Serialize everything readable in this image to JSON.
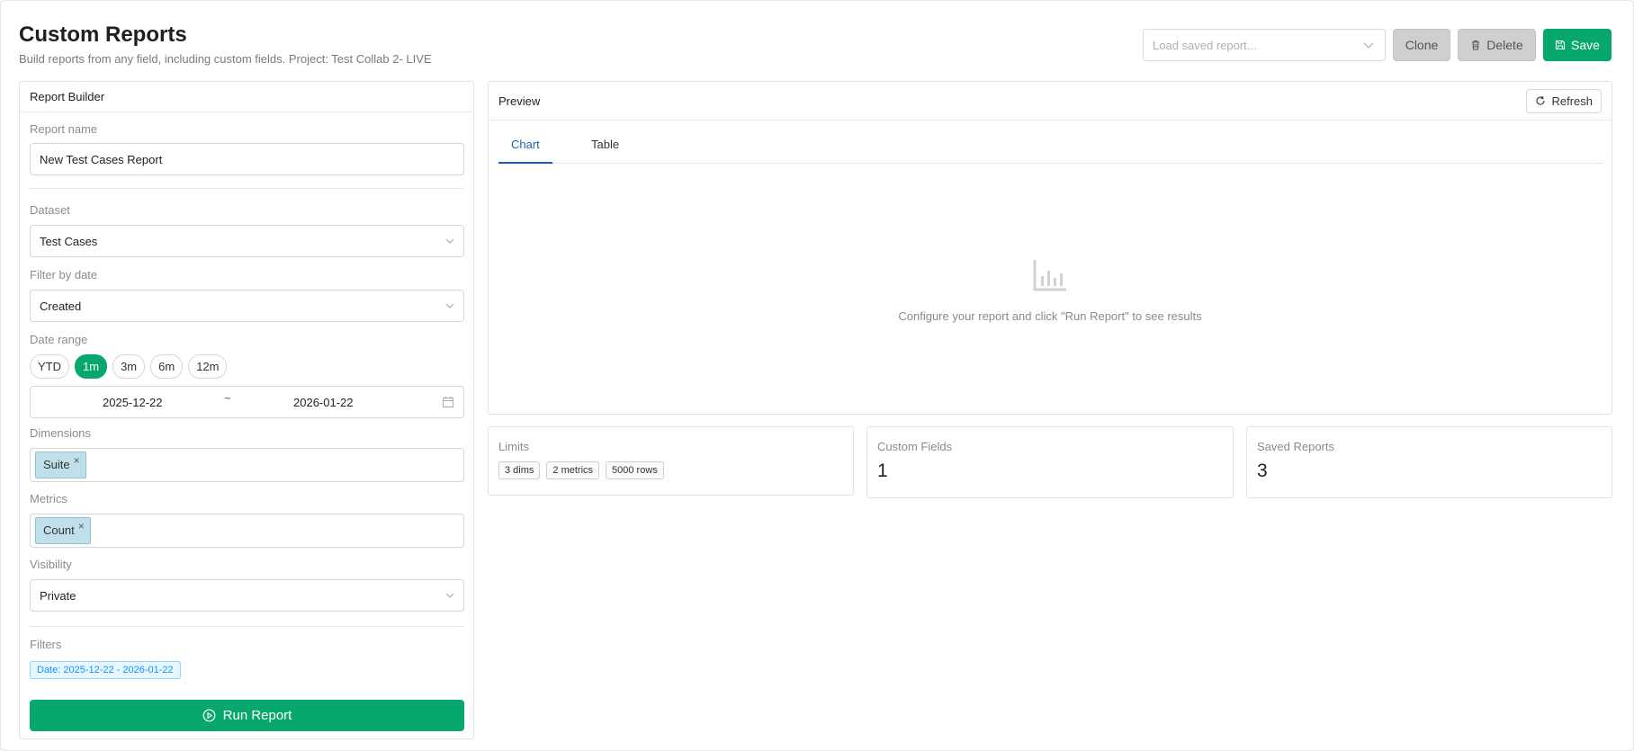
{
  "header": {
    "title": "Custom Reports",
    "subtitle": "Build reports from any field, including custom fields. Project: Test Collab 2- LIVE"
  },
  "toolbar": {
    "load_placeholder": "Load saved report...",
    "clone_label": "Clone",
    "delete_label": "Delete",
    "save_label": "Save"
  },
  "builder": {
    "title": "Report Builder",
    "report_name_label": "Report name",
    "report_name_value": "New Test Cases Report",
    "dataset_label": "Dataset",
    "dataset_value": "Test Cases",
    "filter_date_label": "Filter by date",
    "filter_date_value": "Created",
    "date_range_label": "Date range",
    "ranges": [
      {
        "label": "YTD",
        "active": false
      },
      {
        "label": "1m",
        "active": true
      },
      {
        "label": "3m",
        "active": false
      },
      {
        "label": "6m",
        "active": false
      },
      {
        "label": "12m",
        "active": false
      }
    ],
    "date_start": "2025-12-22",
    "date_separator": "~",
    "date_end": "2026-01-22",
    "dimensions_label": "Dimensions",
    "dimensions": [
      "Suite"
    ],
    "metrics_label": "Metrics",
    "metrics": [
      "Count"
    ],
    "visibility_label": "Visibility",
    "visibility_value": "Private",
    "filters_label": "Filters",
    "filter_badge": "Date: 2025-12-22 - 2026-01-22",
    "run_label": "Run Report"
  },
  "preview": {
    "title": "Preview",
    "refresh_label": "Refresh",
    "tabs": [
      "Chart",
      "Table"
    ],
    "active_tab": "Chart",
    "empty_text": "Configure your report and click \"Run Report\" to see results"
  },
  "stats": {
    "limits_title": "Limits",
    "limits": [
      "3 dims",
      "2 metrics",
      "5000 rows"
    ],
    "custom_fields_title": "Custom Fields",
    "custom_fields_value": "1",
    "saved_reports_title": "Saved Reports",
    "saved_reports_value": "3"
  },
  "colors": {
    "accent_green": "#07a86e",
    "tab_blue": "#1f5fa8",
    "tag_blue": "#bfe0ea",
    "filter_badge_blue": "#1890ff"
  },
  "icons": {
    "load_chevron": "chevron-down-icon",
    "delete": "trash-icon",
    "save": "floppy-disk-icon",
    "refresh": "refresh-icon",
    "calendar": "calendar-icon",
    "run": "play-circle-icon",
    "empty_chart": "bar-chart-icon"
  }
}
